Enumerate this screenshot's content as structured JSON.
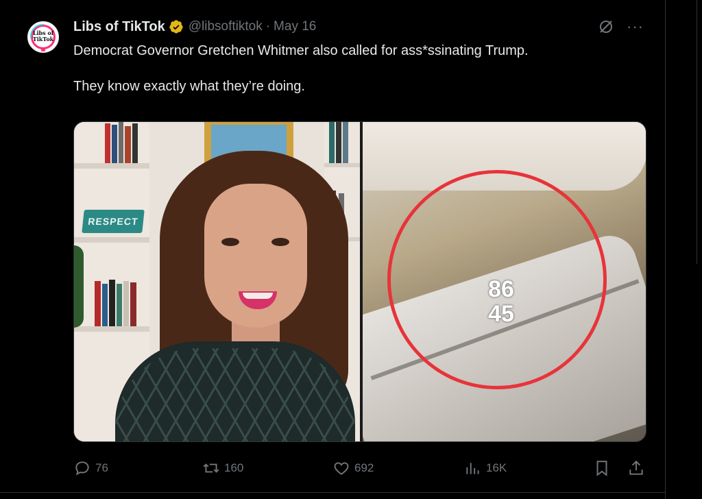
{
  "post": {
    "author_name": "Libs of TikTok",
    "handle": "@libsoftiktok",
    "separator": "·",
    "date": "May 16",
    "more_label": "···",
    "avatar_text": "Libs of\nTikTok",
    "text": "Democrat Governor Gretchen Whitmer also called for ass*ssinating Trump.\n\nThey know exactly what they’re doing.",
    "media": {
      "sign_text": "RESPECT",
      "pin_text_top": "86",
      "pin_text_bottom": "45"
    }
  },
  "actions": {
    "replies": "76",
    "reposts": "160",
    "likes": "692",
    "views": "16K"
  },
  "colors": {
    "background": "#000000",
    "text_primary": "#e7e9ea",
    "text_secondary": "#71767b",
    "verified_badge": "#e2b719",
    "circle_highlight": "#e8333a"
  },
  "icons": [
    "verified-badge-icon",
    "grok-icon",
    "more-icon",
    "reply-icon",
    "repost-icon",
    "like-icon",
    "views-icon",
    "bookmark-icon",
    "share-icon"
  ]
}
